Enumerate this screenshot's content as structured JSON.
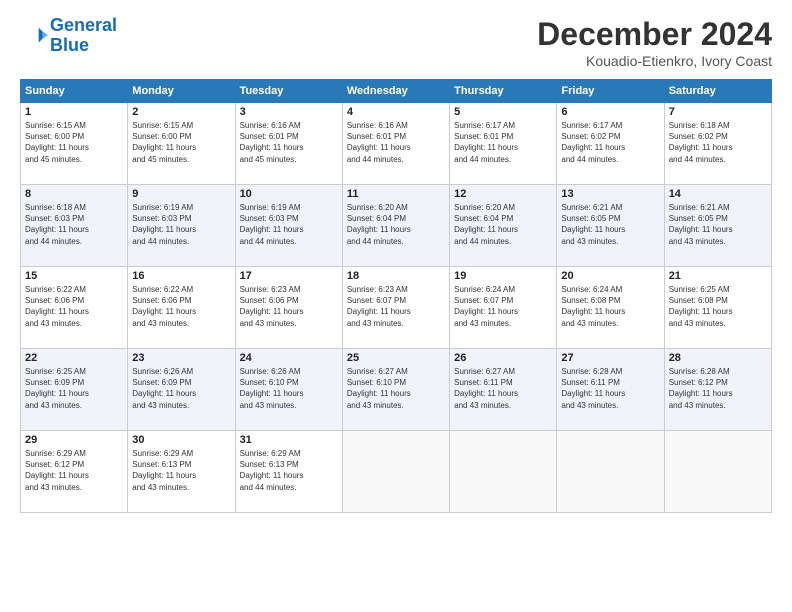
{
  "logo": {
    "line1": "General",
    "line2": "Blue"
  },
  "title": "December 2024",
  "subtitle": "Kouadio-Etienkro, Ivory Coast",
  "days_header": [
    "Sunday",
    "Monday",
    "Tuesday",
    "Wednesday",
    "Thursday",
    "Friday",
    "Saturday"
  ],
  "weeks": [
    [
      {
        "day": 1,
        "info": "Sunrise: 6:15 AM\nSunset: 6:00 PM\nDaylight: 11 hours\nand 45 minutes."
      },
      {
        "day": 2,
        "info": "Sunrise: 6:15 AM\nSunset: 6:00 PM\nDaylight: 11 hours\nand 45 minutes."
      },
      {
        "day": 3,
        "info": "Sunrise: 6:16 AM\nSunset: 6:01 PM\nDaylight: 11 hours\nand 45 minutes."
      },
      {
        "day": 4,
        "info": "Sunrise: 6:16 AM\nSunset: 6:01 PM\nDaylight: 11 hours\nand 44 minutes."
      },
      {
        "day": 5,
        "info": "Sunrise: 6:17 AM\nSunset: 6:01 PM\nDaylight: 11 hours\nand 44 minutes."
      },
      {
        "day": 6,
        "info": "Sunrise: 6:17 AM\nSunset: 6:02 PM\nDaylight: 11 hours\nand 44 minutes."
      },
      {
        "day": 7,
        "info": "Sunrise: 6:18 AM\nSunset: 6:02 PM\nDaylight: 11 hours\nand 44 minutes."
      }
    ],
    [
      {
        "day": 8,
        "info": "Sunrise: 6:18 AM\nSunset: 6:03 PM\nDaylight: 11 hours\nand 44 minutes."
      },
      {
        "day": 9,
        "info": "Sunrise: 6:19 AM\nSunset: 6:03 PM\nDaylight: 11 hours\nand 44 minutes."
      },
      {
        "day": 10,
        "info": "Sunrise: 6:19 AM\nSunset: 6:03 PM\nDaylight: 11 hours\nand 44 minutes."
      },
      {
        "day": 11,
        "info": "Sunrise: 6:20 AM\nSunset: 6:04 PM\nDaylight: 11 hours\nand 44 minutes."
      },
      {
        "day": 12,
        "info": "Sunrise: 6:20 AM\nSunset: 6:04 PM\nDaylight: 11 hours\nand 44 minutes."
      },
      {
        "day": 13,
        "info": "Sunrise: 6:21 AM\nSunset: 6:05 PM\nDaylight: 11 hours\nand 43 minutes."
      },
      {
        "day": 14,
        "info": "Sunrise: 6:21 AM\nSunset: 6:05 PM\nDaylight: 11 hours\nand 43 minutes."
      }
    ],
    [
      {
        "day": 15,
        "info": "Sunrise: 6:22 AM\nSunset: 6:06 PM\nDaylight: 11 hours\nand 43 minutes."
      },
      {
        "day": 16,
        "info": "Sunrise: 6:22 AM\nSunset: 6:06 PM\nDaylight: 11 hours\nand 43 minutes."
      },
      {
        "day": 17,
        "info": "Sunrise: 6:23 AM\nSunset: 6:06 PM\nDaylight: 11 hours\nand 43 minutes."
      },
      {
        "day": 18,
        "info": "Sunrise: 6:23 AM\nSunset: 6:07 PM\nDaylight: 11 hours\nand 43 minutes."
      },
      {
        "day": 19,
        "info": "Sunrise: 6:24 AM\nSunset: 6:07 PM\nDaylight: 11 hours\nand 43 minutes."
      },
      {
        "day": 20,
        "info": "Sunrise: 6:24 AM\nSunset: 6:08 PM\nDaylight: 11 hours\nand 43 minutes."
      },
      {
        "day": 21,
        "info": "Sunrise: 6:25 AM\nSunset: 6:08 PM\nDaylight: 11 hours\nand 43 minutes."
      }
    ],
    [
      {
        "day": 22,
        "info": "Sunrise: 6:25 AM\nSunset: 6:09 PM\nDaylight: 11 hours\nand 43 minutes."
      },
      {
        "day": 23,
        "info": "Sunrise: 6:26 AM\nSunset: 6:09 PM\nDaylight: 11 hours\nand 43 minutes."
      },
      {
        "day": 24,
        "info": "Sunrise: 6:26 AM\nSunset: 6:10 PM\nDaylight: 11 hours\nand 43 minutes."
      },
      {
        "day": 25,
        "info": "Sunrise: 6:27 AM\nSunset: 6:10 PM\nDaylight: 11 hours\nand 43 minutes."
      },
      {
        "day": 26,
        "info": "Sunrise: 6:27 AM\nSunset: 6:11 PM\nDaylight: 11 hours\nand 43 minutes."
      },
      {
        "day": 27,
        "info": "Sunrise: 6:28 AM\nSunset: 6:11 PM\nDaylight: 11 hours\nand 43 minutes."
      },
      {
        "day": 28,
        "info": "Sunrise: 6:28 AM\nSunset: 6:12 PM\nDaylight: 11 hours\nand 43 minutes."
      }
    ],
    [
      {
        "day": 29,
        "info": "Sunrise: 6:29 AM\nSunset: 6:12 PM\nDaylight: 11 hours\nand 43 minutes."
      },
      {
        "day": 30,
        "info": "Sunrise: 6:29 AM\nSunset: 6:13 PM\nDaylight: 11 hours\nand 43 minutes."
      },
      {
        "day": 31,
        "info": "Sunrise: 6:29 AM\nSunset: 6:13 PM\nDaylight: 11 hours\nand 44 minutes."
      },
      null,
      null,
      null,
      null
    ]
  ]
}
